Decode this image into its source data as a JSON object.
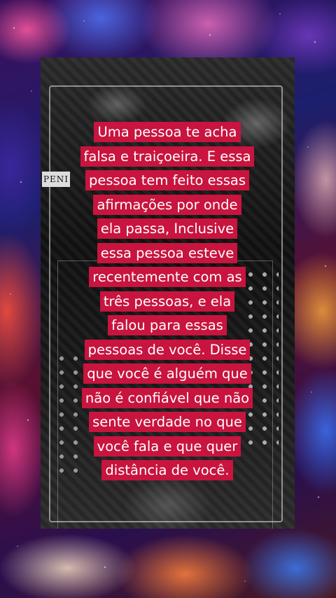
{
  "background": {
    "style": "cosmic-nebula",
    "colors": [
      "#3b0f5a",
      "#1b1f6e",
      "#5a1030",
      "#ff5aa0",
      "#5078ff",
      "#ff7a3c"
    ]
  },
  "video": {
    "card_label": "PENI",
    "caption_highlight_color": "#c8143e",
    "caption_lines": [
      "Uma pessoa te acha",
      "falsa e traiçoeira. E essa",
      "pessoa tem feito essas",
      "afirmações por onde",
      "ela passa, Inclusive",
      "essa pessoa esteve",
      "recentemente com as",
      "três pessoas, e ela",
      "falou para essas",
      "pessoas de você. Disse",
      "que você é alguém que",
      "não é confiável que não",
      "sente verdade no que",
      "você fala e que quer",
      "distância de você."
    ]
  }
}
